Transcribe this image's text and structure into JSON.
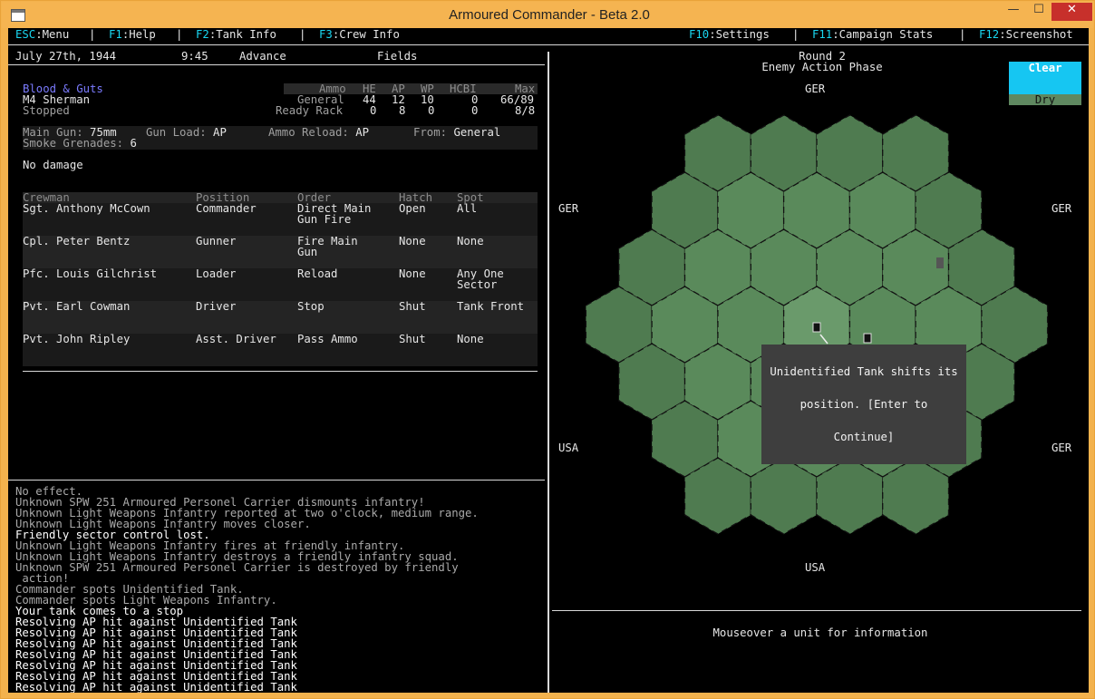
{
  "window": {
    "title": "Armoured Commander - Beta 2.0",
    "min": "—",
    "max": "☐",
    "close": "✕"
  },
  "menu": {
    "esc_key": "ESC",
    "esc_label": ":Menu",
    "f1_key": "F1",
    "f1_label": ":Help",
    "f2_key": "F2",
    "f2_label": ":Tank Info",
    "f3_key": "F3",
    "f3_label": ":Crew Info",
    "f10_key": "F10",
    "f10_label": ":Settings",
    "f11_key": "F11",
    "f11_label": ":Campaign Stats",
    "f12_key": "F12",
    "f12_label": ":Screenshot",
    "sep": "|"
  },
  "status": {
    "date": "July 27th, 1944",
    "time": "9:45",
    "mode": "Advance",
    "terrain": "Fields"
  },
  "tank": {
    "name": "Blood & Guts",
    "model": "M4 Sherman",
    "state": "Stopped",
    "ammo_headers": {
      "ammo": "Ammo",
      "he": "HE",
      "ap": "AP",
      "wp": "WP",
      "hcbi": "HCBI",
      "max": "Max"
    },
    "ammo_rows": [
      {
        "label": "General",
        "he": "44",
        "ap": "12",
        "wp": "10",
        "hcbi": "0",
        "max": "66/89"
      },
      {
        "label": "Ready Rack",
        "he": "0",
        "ap": "8",
        "wp": "0",
        "hcbi": "0",
        "max": "8/8"
      }
    ],
    "main_gun_label": "Main Gun:",
    "main_gun": "75mm",
    "gun_load_label": "Gun Load:",
    "gun_load": "AP",
    "ammo_reload_label": "Ammo Reload:",
    "ammo_reload": "AP",
    "from_label": "From:",
    "from": "General",
    "smoke_label": "Smoke Grenades:",
    "smoke": "6",
    "damage": "No damage"
  },
  "crew": {
    "headers": {
      "name": "Crewman",
      "position": "Position",
      "order": "Order",
      "hatch": "Hatch",
      "spot": "Spot"
    },
    "rows": [
      {
        "name": "Sgt. Anthony McCown",
        "position": "Commander",
        "order1": "Direct Main",
        "order2": "Gun Fire",
        "hatch": "Open",
        "spot1": "All",
        "spot2": ""
      },
      {
        "name": "Cpl. Peter Bentz",
        "position": "Gunner",
        "order1": "Fire Main",
        "order2": "Gun",
        "hatch": "None",
        "spot1": "None",
        "spot2": ""
      },
      {
        "name": "Pfc. Louis Gilchrist",
        "position": "Loader",
        "order1": "Reload",
        "order2": "",
        "hatch": "None",
        "spot1": "Any One",
        "spot2": "Sector"
      },
      {
        "name": "Pvt. Earl Cowman",
        "position": "Driver",
        "order1": "Stop",
        "order2": "",
        "hatch": "Shut",
        "spot1": "Tank Front",
        "spot2": ""
      },
      {
        "name": "Pvt. John Ripley",
        "position": "Asst. Driver",
        "order1": "Pass Ammo",
        "order2": "",
        "hatch": "Shut",
        "spot1": "None",
        "spot2": ""
      }
    ]
  },
  "log": [
    {
      "text": "No effect.",
      "bright": false
    },
    {
      "text": "Unknown SPW 251 Armoured Personel Carrier dismounts infantry!",
      "bright": false
    },
    {
      "text": "Unknown Light Weapons Infantry reported at two o'clock, medium range.",
      "bright": false
    },
    {
      "text": "Unknown Light Weapons Infantry moves closer.",
      "bright": false
    },
    {
      "text": "Friendly sector control lost.",
      "bright": true
    },
    {
      "text": "Unknown Light Weapons Infantry fires at friendly infantry.",
      "bright": false
    },
    {
      "text": "Unknown Light Weapons Infantry destroys a friendly infantry squad.",
      "bright": false
    },
    {
      "text": "Unknown SPW 251 Armoured Personel Carrier is destroyed by friendly",
      "bright": false
    },
    {
      "text": " action!",
      "bright": false
    },
    {
      "text": "Commander spots Unidentified Tank.",
      "bright": false
    },
    {
      "text": "Commander spots Light Weapons Infantry.",
      "bright": false
    },
    {
      "text": "Your tank comes to a stop",
      "bright": true
    },
    {
      "text": "Resolving AP hit against Unidentified Tank",
      "bright": true
    },
    {
      "text": "Resolving AP hit against Unidentified Tank",
      "bright": true
    },
    {
      "text": "Resolving AP hit against Unidentified Tank",
      "bright": true
    },
    {
      "text": "Resolving AP hit against Unidentified Tank",
      "bright": true
    },
    {
      "text": "Resolving AP hit against Unidentified Tank",
      "bright": true
    },
    {
      "text": "Resolving AP hit against Unidentified Tank",
      "bright": true
    },
    {
      "text": "Resolving AP hit against Unidentified Tank",
      "bright": true
    }
  ],
  "battle": {
    "round": "Round 2",
    "phase": "Enemy Action Phase",
    "weather_sky": "Clear",
    "weather_ground": "Dry",
    "labels": {
      "top": "GER",
      "upper_left": "GER",
      "upper_right": "GER",
      "lower_left": "USA",
      "lower_right": "GER",
      "bottom": "USA"
    },
    "message_lines": [
      "Unidentified Tank shifts its",
      "position. [Enter to",
      "Continue]"
    ],
    "info": "Mouseover a unit for information",
    "colors": {
      "hex_outer": "#4f7b50",
      "hex_mid": "#5a8a5b",
      "hex_inner": "#6a9a6b"
    }
  }
}
